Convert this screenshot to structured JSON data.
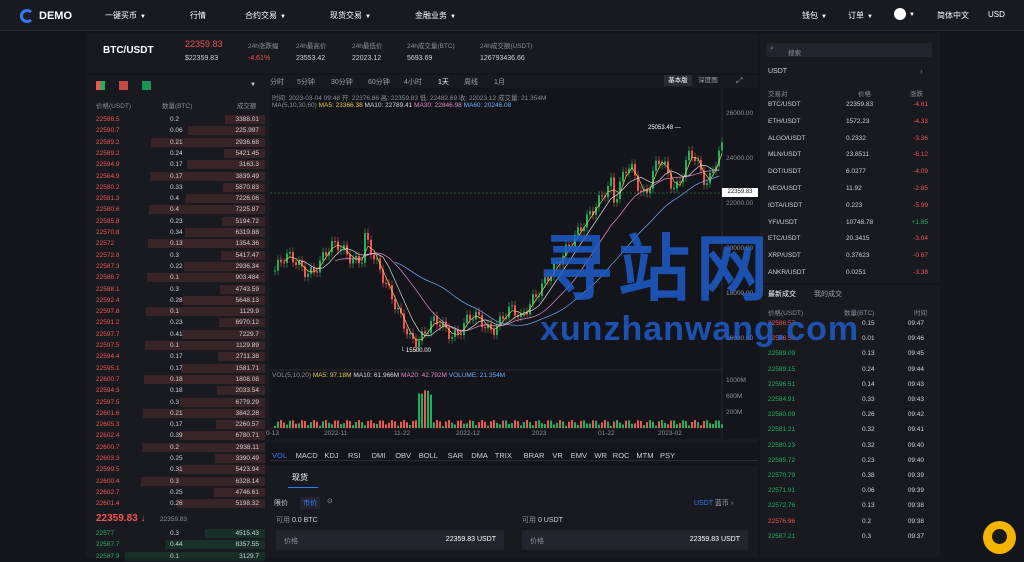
{
  "nav": {
    "logo": "DEMO",
    "items": [
      "一键买币",
      "行情",
      "合约交易",
      "现货交易",
      "金融业务"
    ],
    "right": [
      "钱包",
      "订单",
      "简体中文",
      "USD"
    ]
  },
  "ticker": {
    "pair": "BTC/USDT",
    "price": "22359.83",
    "usd": "$22359.83",
    "stats": [
      {
        "label": "24h涨跌幅",
        "value": "-4.61%"
      },
      {
        "label": "24h最高价",
        "value": "23553.42"
      },
      {
        "label": "24h最低价",
        "value": "22023.12"
      },
      {
        "label": "24h成交量(BTC)",
        "value": "5693.69"
      },
      {
        "label": "24h成交额(USDT)",
        "value": "126793436.66"
      }
    ]
  },
  "orderbook": {
    "headers": [
      "价格(USDT)",
      "数量(BTC)",
      "成交额"
    ],
    "asks": [
      [
        "22586.5",
        "0.2",
        "3388.01"
      ],
      [
        "22590.7",
        "0.06",
        "225.997"
      ],
      [
        "22589.2",
        "0.21",
        "2936.68"
      ],
      [
        "22589.2",
        "0.24",
        "5421.45"
      ],
      [
        "22594.9",
        "0.17",
        "3163.3"
      ],
      [
        "22584.9",
        "0.17",
        "3839.49"
      ],
      [
        "22580.2",
        "0.33",
        "5870.83"
      ],
      [
        "22581.3",
        "0.4",
        "7226.06"
      ],
      [
        "22580.6",
        "0.4",
        "7225.87"
      ],
      [
        "22585.8",
        "0.23",
        "5194.72"
      ],
      [
        "22570.8",
        "0.34",
        "6319.88"
      ],
      [
        "22572",
        "0.13",
        "1354.36"
      ],
      [
        "22572.8",
        "0.3",
        "5417.47"
      ],
      [
        "22587.3",
        "0.22",
        "2936.34"
      ],
      [
        "22586.7",
        "0.1",
        "903.484"
      ],
      [
        "22588.1",
        "0.3",
        "4743.59"
      ],
      [
        "22592.4",
        "0.28",
        "5648.13"
      ],
      [
        "22597.8",
        "0.1",
        "1129.9"
      ],
      [
        "22591.2",
        "0.23",
        "6970.12"
      ],
      [
        "22597.7",
        "0.41",
        "7229.7"
      ],
      [
        "22597.5",
        "0.1",
        "1129.89"
      ],
      [
        "22594.4",
        "0.17",
        "2711.38"
      ],
      [
        "22595.1",
        "0.17",
        "1581.71"
      ],
      [
        "22600.7",
        "0.18",
        "1808.08"
      ],
      [
        "22594.3",
        "0.18",
        "2033.54"
      ],
      [
        "22597.5",
        "0.3",
        "6779.29"
      ],
      [
        "22601.6",
        "0.21",
        "3842.28"
      ],
      [
        "22605.3",
        "0.17",
        "2260.57"
      ],
      [
        "22602.4",
        "0.39",
        "6780.71"
      ],
      [
        "22600.7",
        "0.2",
        "2938.11"
      ],
      [
        "22603.3",
        "0.25",
        "3390.49"
      ],
      [
        "22599.5",
        "0.31",
        "5423.94"
      ],
      [
        "22600.4",
        "0.3",
        "6328.14"
      ],
      [
        "22602.7",
        "0.25",
        "4746.61"
      ],
      [
        "22601.4",
        "0.26",
        "5198.32"
      ]
    ],
    "last": "22359.83",
    "last_sub": "22359.83",
    "bids": [
      [
        "22577",
        "0.3",
        "4515.43"
      ],
      [
        "22587.7",
        "0.44",
        "8357.55"
      ],
      [
        "22587.9",
        "0.1",
        "3129.7"
      ]
    ]
  },
  "timeframes": [
    "分时",
    "5分钟",
    "30分钟",
    "60分钟",
    "4小时",
    "1天",
    "周线",
    "1月"
  ],
  "chart_views": [
    "基本版",
    "深度图"
  ],
  "chart_data": {
    "type": "candlestick",
    "date": "2023-03-04 09:48",
    "open": "22376.86",
    "high": "22359.83",
    "low": "22482.69",
    "close": "22023.12",
    "volume": "21.354M",
    "ma_label": "MA(5,10,30,60)",
    "ma": [
      "MA5: 23366.38",
      "MA10: 22789.41",
      "MA30: 22846.98",
      "MA60: 20246.08"
    ],
    "y_ticks": [
      "26000.00",
      "24000.00",
      "22000.00",
      "20000.00",
      "18000.00",
      "16000.00"
    ],
    "x_ticks": [
      "0-13",
      "2022-11",
      "11-22",
      "2022-12",
      "2023",
      "01-22",
      "2023-02"
    ],
    "max_label": "25053.48",
    "min_label": "15500.00",
    "last_label": "22359.83",
    "vol_label": "VOL(5,10,20)",
    "vol_ma": [
      "MA5: 97.18M",
      "MA10: 61.966M",
      "MA20: 42.792M",
      "VOLUME: 21.354M"
    ],
    "vol_ticks": [
      "1000M",
      "600M",
      "200M"
    ]
  },
  "indicators": [
    "VOL",
    "MACD",
    "KDJ",
    "RSI",
    "DMI",
    "OBV",
    "BOLL",
    "SAR",
    "DMA",
    "TRIX",
    "BRAR",
    "VR",
    "EMV",
    "WR",
    "ROC",
    "MTM",
    "PSY"
  ],
  "trade": {
    "tab": "现货",
    "order_types": [
      "限价",
      "市价"
    ],
    "avail_left": "可用",
    "avail_left_val": "0.0 BTC",
    "avail_right": "可用",
    "avail_right_val": "0 USDT",
    "price_label": "价格",
    "price_val": "22359.83 USDT",
    "price_val2": "22359.83 USDT",
    "coin": "USDT",
    "link": "蓝币"
  },
  "market": {
    "search_placeholder": "搜索",
    "quote": "USDT",
    "headers": [
      "交易对",
      "价格",
      "涨跌"
    ],
    "rows": [
      [
        "BTC/USDT",
        "22359.83",
        "-4.61"
      ],
      [
        "ETH/USDT",
        "1572.23",
        "-4.33"
      ],
      [
        "ALGO/USDT",
        "0.2332",
        "-3.36"
      ],
      [
        "MLN/USDT",
        "23.8511",
        "-6.12"
      ],
      [
        "DOT/USDT",
        "6.0277",
        "-4.09"
      ],
      [
        "NEO/USDT",
        "11.92",
        "-2.85"
      ],
      [
        "IOTA/USDT",
        "0.223",
        "-5.99"
      ],
      [
        "YFI/USDT",
        "10748.78",
        "+1.85"
      ],
      [
        "ETC/USDT",
        "20.3415",
        "-3.04"
      ],
      [
        "XRP/USDT",
        "0.37623",
        "-0.67"
      ],
      [
        "ANKR/USDT",
        "0.0251",
        "-3.38"
      ]
    ]
  },
  "trades": {
    "tabs": [
      "最新成交",
      "我的成交"
    ],
    "headers": [
      "价格(USDT)",
      "数量(BTC)",
      "时间"
    ],
    "rows": [
      [
        "22586.57",
        "0.15",
        "09:47"
      ],
      [
        "22596.56",
        "0.01",
        "09:46"
      ],
      [
        "22589.09",
        "0.13",
        "09:45"
      ],
      [
        "22589.15",
        "0.24",
        "09:44"
      ],
      [
        "22596.51",
        "0.14",
        "09:43"
      ],
      [
        "22584.91",
        "0.33",
        "09:43"
      ],
      [
        "22580.09",
        "0.26",
        "09:42"
      ],
      [
        "22581.21",
        "0.32",
        "09:41"
      ],
      [
        "22580.23",
        "0.32",
        "09:40"
      ],
      [
        "22585.72",
        "0.23",
        "09:40"
      ],
      [
        "22570.79",
        "0.38",
        "09:39"
      ],
      [
        "22571.91",
        "0.06",
        "09:39"
      ],
      [
        "22572.76",
        "0.13",
        "09:38"
      ],
      [
        "22576.96",
        "0.2",
        "09:38"
      ],
      [
        "22587.21",
        "0.3",
        "09:37"
      ]
    ]
  },
  "watermark": {
    "cn": "寻站网",
    "en": "xunzhanwang.com"
  },
  "colors": {
    "up": "#21b15e",
    "down": "#f0564f",
    "accent": "#2f7bff"
  }
}
